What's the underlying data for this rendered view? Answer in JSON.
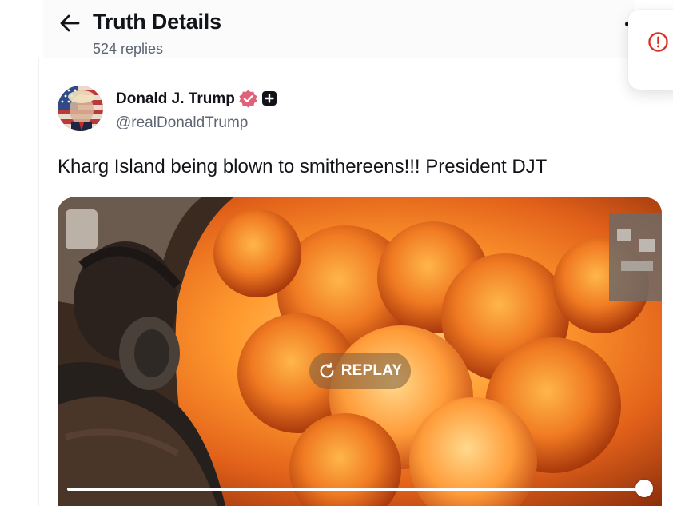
{
  "header": {
    "title": "Truth Details",
    "subtitle": "524 replies",
    "back_icon": "arrow-left-icon"
  },
  "notice": {
    "icon": "alert-circle-icon",
    "color": "#d93025"
  },
  "post": {
    "author": {
      "name": "Donald J. Trump",
      "handle": "@realDonaldTrump",
      "verified_icon": "verified-badge-icon",
      "verified_color": "#e0617a",
      "plus_icon": "plus-square-icon"
    },
    "text": "Kharg Island being blown to smithereens!!! President DJT",
    "video": {
      "replay_label": "REPLAY",
      "replay_icon": "replay-icon",
      "progress": 1.0
    }
  }
}
